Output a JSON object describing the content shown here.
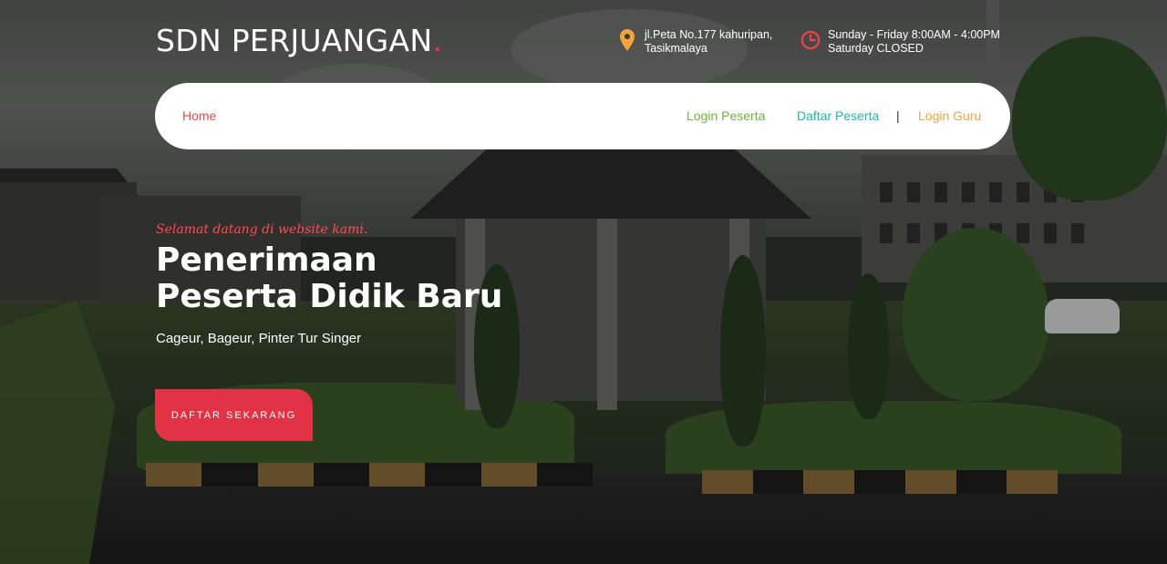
{
  "brand": {
    "name": "SDN PERJUANGAN",
    "dot": "."
  },
  "header": {
    "address": {
      "icon": "map-pin-icon",
      "line1": "jl.Peta No.177 kahuripan,",
      "line2": "Tasikmalaya"
    },
    "hours": {
      "icon": "clock-icon",
      "line1": "Sunday - Friday 8:00AM - 4:00PM",
      "line2": "Saturday CLOSED"
    }
  },
  "nav": {
    "home": "Home",
    "login_peserta": "Login Peserta",
    "daftar_peserta": "Daftar Peserta",
    "separator": "|",
    "login_guru": "Login Guru"
  },
  "hero": {
    "welcome": "Selamat datang di website kami.",
    "title_line1": "Penerimaan",
    "title_line2": "Peserta Didik Baru",
    "subtitle": "Cageur, Bageur, Pinter Tur Singer",
    "cta": "DAFTAR SEKARANG"
  },
  "colors": {
    "accent_red": "#e23246",
    "home_link": "#e8474a",
    "login_peserta": "#6cb33f",
    "daftar_peserta": "#1fb8b2",
    "login_guru": "#f3a43a",
    "address_icon": "#f3a43a",
    "clock_icon": "#e8474a"
  }
}
